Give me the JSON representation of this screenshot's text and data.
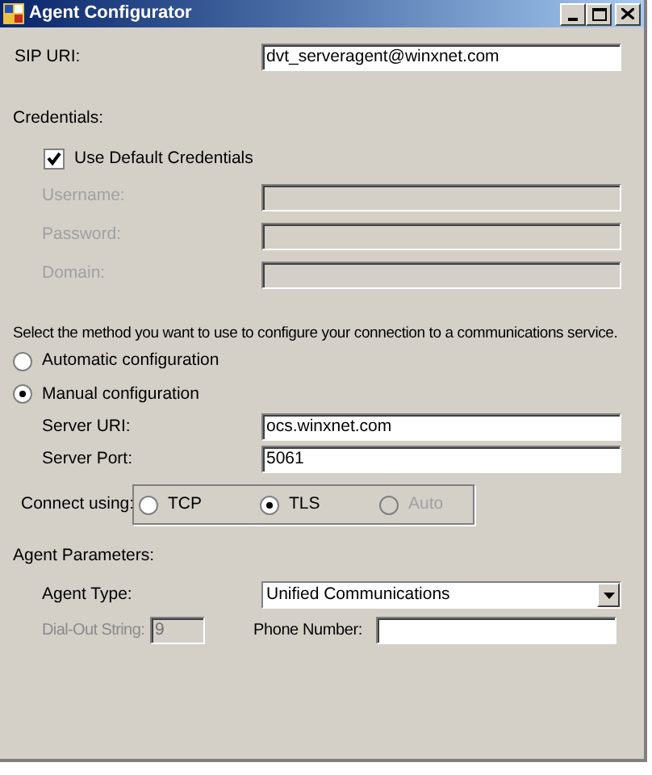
{
  "window": {
    "title": "Agent Configurator"
  },
  "sip_uri": {
    "label": "SIP URI:",
    "value": "dvt_serveragent@winxnet.com"
  },
  "credentials": {
    "heading": "Credentials:",
    "use_default": {
      "label": "Use Default Credentials",
      "checked": true
    },
    "fields": [
      {
        "label": "Username:",
        "disabled": true
      },
      {
        "label": "Password:",
        "disabled": true
      },
      {
        "label": "Domain:",
        "disabled": true
      }
    ]
  },
  "method": {
    "prompt": "Select the method you want to use to configure your connection to a communications service.",
    "options": [
      {
        "label": "Automatic configuration",
        "selected": false
      },
      {
        "label": "Manual configuration",
        "selected": true
      }
    ]
  },
  "server_fields": [
    {
      "label": "Server URI:",
      "value": "ocs.winxnet.com"
    },
    {
      "label": "Server Port:",
      "value": "5061"
    }
  ],
  "connect_using": {
    "label": "Connect using:",
    "options": [
      {
        "label": "TCP",
        "selected": false,
        "disabled": false
      },
      {
        "label": "TLS",
        "selected": true,
        "disabled": false
      },
      {
        "label": "Auto",
        "selected": false,
        "disabled": true
      }
    ]
  },
  "agent_parameters": {
    "heading": "Agent Parameters:",
    "agent_type": {
      "label": "Agent Type:",
      "value": "Unified Communications"
    },
    "dial_out": {
      "label": "Dial-Out String:",
      "value": "9",
      "disabled": true
    },
    "phone_number": {
      "label": "Phone Number:"
    }
  }
}
